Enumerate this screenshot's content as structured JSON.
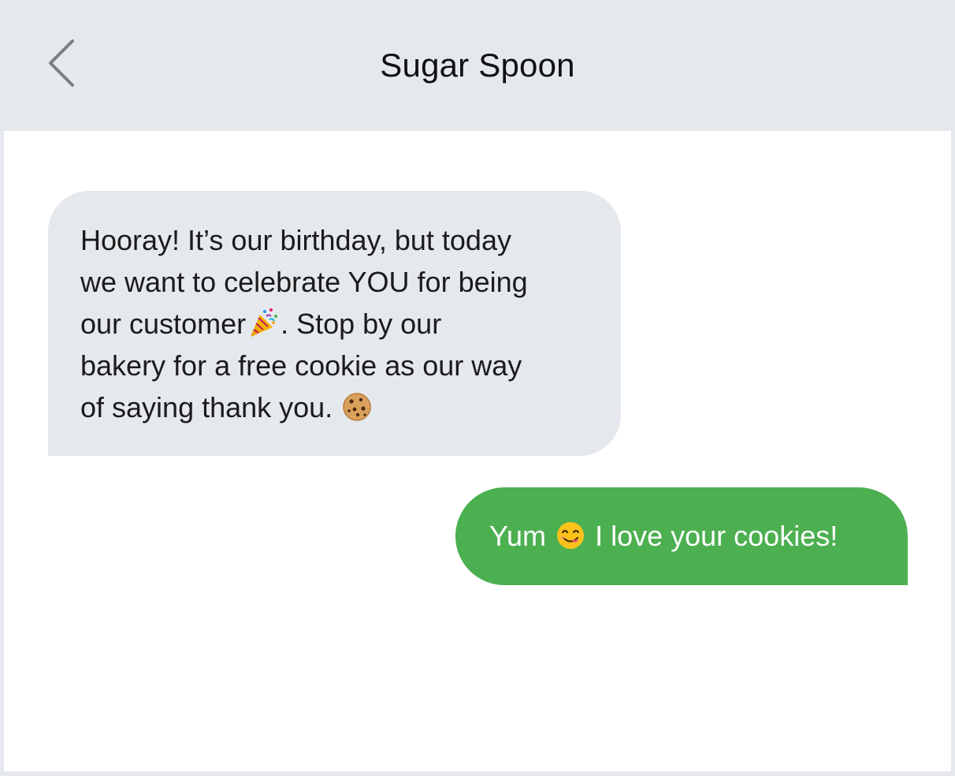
{
  "header": {
    "title": "Sugar Spoon",
    "back_icon": "chevron-left-icon"
  },
  "messages": [
    {
      "direction": "incoming",
      "lines": [
        "Hooray! It’s our birthday, but today",
        "we want to celebrate YOU for being",
        "our customer",
        ". Stop by our",
        "bakery for a free cookie as our way",
        "of saying thank you."
      ],
      "emojis": [
        "party-popper-icon",
        "cookie-icon"
      ]
    },
    {
      "direction": "outgoing",
      "text_before": "Yum",
      "text_after": "I love your cookies!",
      "emoji": "yum-face-icon"
    }
  ],
  "colors": {
    "header_bg": "#e5e8ec",
    "incoming_bubble": "#e5e8ec",
    "outgoing_bubble": "#4caf50"
  }
}
